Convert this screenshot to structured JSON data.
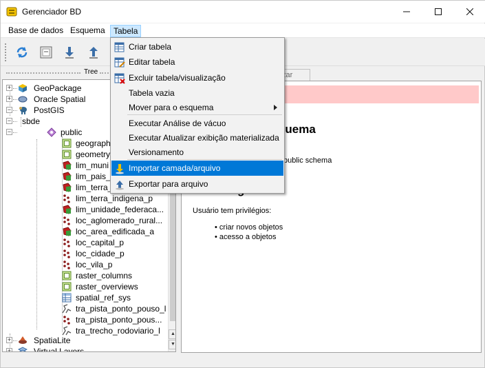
{
  "window": {
    "title": "Gerenciador BD",
    "minimize": "—",
    "maximize": "☐",
    "close": "✕"
  },
  "menubar": {
    "items": [
      "Base de dados",
      "Esquema",
      "Tabela"
    ]
  },
  "dock": {
    "title": "Tree"
  },
  "tree": {
    "nodes": [
      {
        "label": "GeoPackage",
        "icon": "geopackage-icon",
        "expander": "+"
      },
      {
        "label": "Oracle Spatial",
        "icon": "oracle-icon",
        "expander": "+"
      },
      {
        "label": "PostGIS",
        "icon": "postgis-elephant-icon",
        "expander": "−"
      },
      {
        "label": "sbde",
        "icon": "",
        "expander": "−"
      },
      {
        "label": "public",
        "icon": "schema-icon",
        "expander": "−"
      },
      {
        "label": "geograph",
        "icon": "table-green-icon"
      },
      {
        "label": "geometry",
        "icon": "table-green-icon"
      },
      {
        "label": "lim_muni",
        "icon": "polygon-layer-icon"
      },
      {
        "label": "lim_pais_a",
        "icon": "polygon-layer-icon"
      },
      {
        "label": "lim_terra_",
        "icon": "polygon-layer-icon"
      },
      {
        "label": "lim_terra_indigena_p",
        "icon": "point-layer-icon"
      },
      {
        "label": "lim_unidade_federaca...",
        "icon": "polygon-layer-icon"
      },
      {
        "label": "loc_aglomerado_rural...",
        "icon": "point-layer-icon"
      },
      {
        "label": "loc_area_edificada_a",
        "icon": "polygon-layer-icon"
      },
      {
        "label": "loc_capital_p",
        "icon": "point-layer-icon"
      },
      {
        "label": "loc_cidade_p",
        "icon": "point-layer-icon"
      },
      {
        "label": "loc_vila_p",
        "icon": "point-layer-icon"
      },
      {
        "label": "raster_columns",
        "icon": "table-green-icon"
      },
      {
        "label": "raster_overviews",
        "icon": "table-green-icon"
      },
      {
        "label": "spatial_ref_sys",
        "icon": "table-blue-icon"
      },
      {
        "label": "tra_pista_ponto_pouso_l",
        "icon": "line-layer-icon"
      },
      {
        "label": "tra_pista_ponto_pous...",
        "icon": "point-layer-icon"
      },
      {
        "label": "tra_trecho_rodoviario_l",
        "icon": "line-layer-icon"
      },
      {
        "label": "SpatiaLite",
        "icon": "spatialite-icon",
        "expander": "+"
      },
      {
        "label": "Virtual Layers",
        "icon": "virtual-layers-icon",
        "expander": "+"
      }
    ]
  },
  "right": {
    "tab_label": "alizar",
    "schema_title": "quema",
    "schema_line": "public schema",
    "priv_title": "Privilégios",
    "priv_line": "Usuário tem privilégios:",
    "bullets": [
      "criar novos objetos",
      "acesso a objetos"
    ]
  },
  "dropdown": {
    "items": [
      {
        "label": "Criar tabela",
        "icon": "create-table-icon"
      },
      {
        "label": "Editar tabela",
        "icon": "edit-table-icon"
      },
      {
        "label": "Excluir tabela/visualização",
        "icon": "delete-table-icon"
      },
      {
        "label": "Tabela vazia",
        "icon": ""
      },
      {
        "label": "Mover para o esquema",
        "icon": ""
      },
      {
        "label": "Executar Análise de vácuo",
        "icon": ""
      },
      {
        "label": "Executar Atualizar exibição materializada",
        "icon": ""
      },
      {
        "label": "Versionamento",
        "icon": ""
      },
      {
        "label": "Importar camada/arquivo",
        "icon": "import-layer-icon"
      },
      {
        "label": "Exportar para arquivo",
        "icon": "export-file-icon"
      }
    ]
  },
  "colors": {
    "highlight": "#0078d7",
    "menu_active": "#cce8ff",
    "alert_bg": "#ffc9c9"
  }
}
